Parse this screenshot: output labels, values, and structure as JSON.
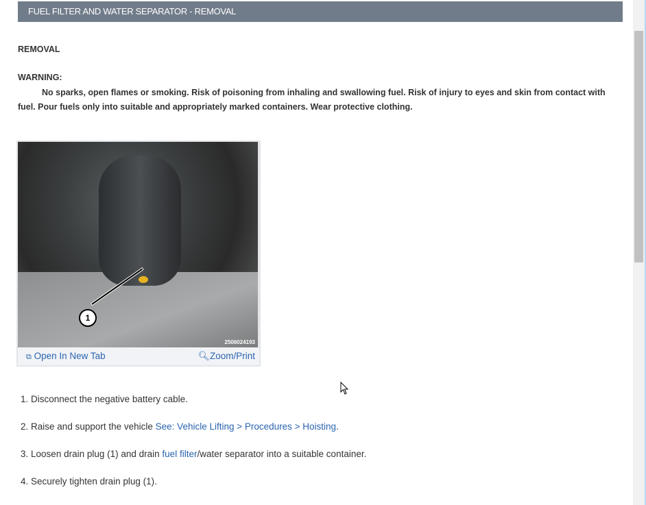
{
  "header": {
    "title": "FUEL FILTER AND WATER SEPARATOR - REMOVAL"
  },
  "section": {
    "heading": "REMOVAL",
    "warning_label": "WARNING:",
    "warning_text": "No sparks, open flames or smoking. Risk of poisoning from inhaling and swallowing fuel. Risk of injury to eyes and skin from contact with fuel. Pour fuels only into suitable and appropriately marked containers. Wear protective clothing."
  },
  "figure": {
    "callout": "1",
    "image_id": "2506024193",
    "open_tab_label": "Open In New Tab",
    "zoom_label": "Zoom/Print",
    "open_tab_icon": "open-new-tab-icon",
    "zoom_icon": "zoom-in-icon"
  },
  "steps": [
    {
      "num": "1.",
      "text": "Disconnect the negative battery cable."
    },
    {
      "num": "2.",
      "pre": "Raise and support the vehicle ",
      "link": "See: Vehicle Lifting > Procedures > Hoisting",
      "post": "."
    },
    {
      "num": "3.",
      "pre": "Loosen drain plug (1) and drain ",
      "link": "fuel filter",
      "post": "/water separator into a suitable container."
    },
    {
      "num": "4.",
      "text": "Securely tighten drain plug (1)."
    }
  ]
}
